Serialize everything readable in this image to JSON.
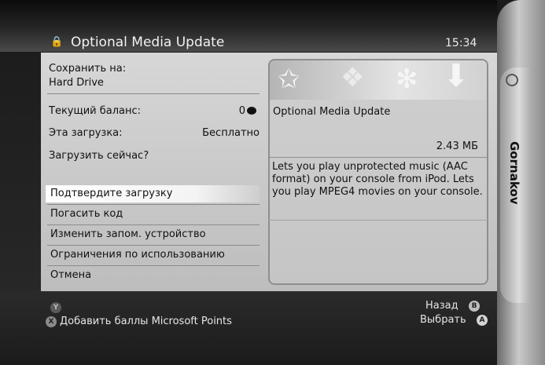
{
  "header": {
    "title": "Optional Media Update",
    "clock": "15:34"
  },
  "left": {
    "save_to_label": "Сохранить на:",
    "save_to_value": "Hard Drive",
    "balance_label": "Текущий баланс:",
    "balance_value": "0",
    "download_label": "Эта загрузка:",
    "download_value": "Бесплатно",
    "question": "Загрузить сейчас?"
  },
  "menu": [
    {
      "label": "Подтвердите загрузку",
      "selected": true
    },
    {
      "label": "Погасить код"
    },
    {
      "label": "Изменить запом. устройство"
    },
    {
      "label": "Ограничения по использованию"
    },
    {
      "label": "Отмена"
    }
  ],
  "info": {
    "title": "Optional Media Update",
    "size": "2.43 МБ",
    "description": "Lets you play unprotected music (AAC format) on your console from iPod. Lets you play MPEG4 movies on your console."
  },
  "blade": {
    "label": "Gornakov"
  },
  "footer": {
    "y_button": "Y",
    "x_button": "X",
    "x_label": "Добавить баллы Microsoft Points",
    "b_label": "Назад",
    "b_button": "B",
    "a_label": "Выбрать",
    "a_button": "A"
  }
}
